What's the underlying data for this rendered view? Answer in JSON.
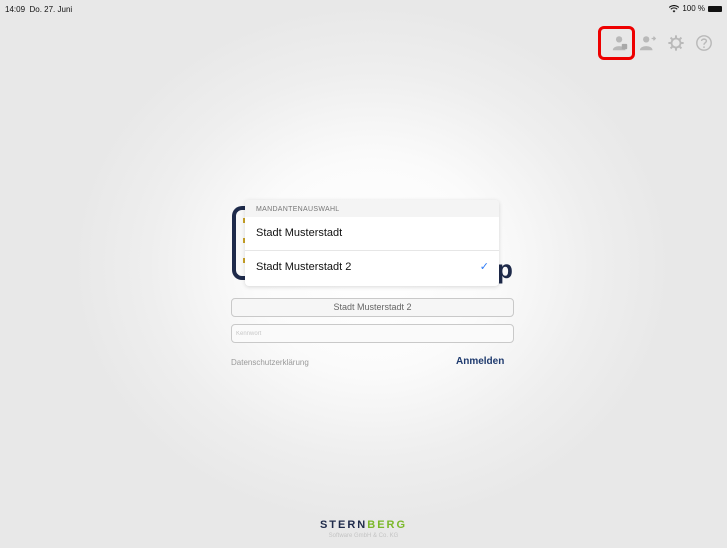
{
  "status_bar": {
    "time": "14:09",
    "date": "Do. 27. Juni",
    "battery": "100 %"
  },
  "toolbar": {
    "icons": [
      "user-icon",
      "user-switch-icon",
      "gear-icon",
      "help-icon"
    ],
    "highlight_color": "#e00000"
  },
  "client_picker": {
    "header": "MANDANTENAUSWAHL",
    "options": [
      "Stadt Musterstadt",
      "Stadt Musterstadt 2"
    ],
    "selected_index": 1,
    "check_color": "#2f7cf6"
  },
  "logo_suffix": "p",
  "login_form": {
    "client_value": "Stadt Musterstadt 2",
    "password_placeholder": "Kennwort",
    "privacy_link": "Datenschutzerklärung",
    "login_button": "Anmelden"
  },
  "footer": {
    "brand_main": "STERN",
    "brand_accent": "BERG",
    "brand_accent_color": "#7bb82a",
    "brand_subline": "Software GmbH & Co. KG"
  }
}
